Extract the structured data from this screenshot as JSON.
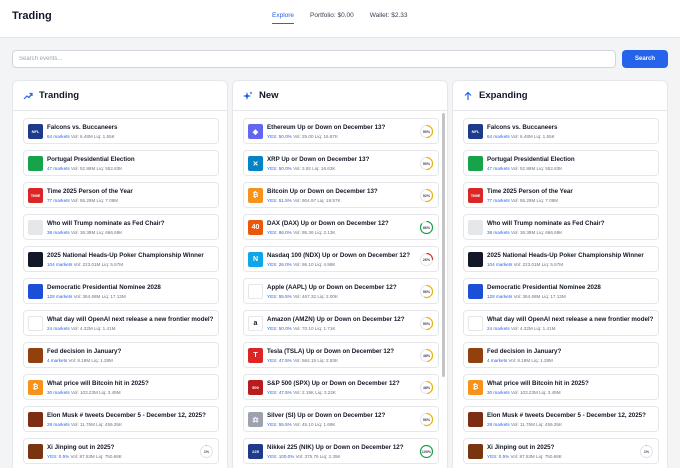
{
  "app": {
    "title": "Trading"
  },
  "nav": {
    "explore": "Explore",
    "portfolio": "Portfolio: $0.00",
    "wallet": "Wallet: $2.33"
  },
  "search": {
    "placeholder": "Search events...",
    "button": "Search"
  },
  "columns": [
    {
      "title": "Tranding",
      "icon": "trending-up-icon",
      "items": [
        {
          "title": "Falcons vs. Buccaneers",
          "meta1": "64 markets",
          "meta2": "Vol: 6.48M  Liq: 1.65K",
          "thumb": "nfl-logo",
          "thumb_color": "#1e3a8a",
          "thumb_text": "NFL"
        },
        {
          "title": "Portugal Presidential Election",
          "meta1": "47 markets",
          "meta2": "Vol: 52.88M  Liq: 552.83K",
          "thumb": "portugal-flag",
          "thumb_color": "#16a34a",
          "thumb_text": ""
        },
        {
          "title": "Time 2025 Person of the Year",
          "meta1": "77 markets",
          "meta2": "Vol: 55.29M  Liq: 7.09M",
          "thumb": "time-magazine-logo",
          "thumb_color": "#dc2626",
          "thumb_text": "TIME"
        },
        {
          "title": "Who will Trump nominate as Fed Chair?",
          "meta1": "38 markets",
          "meta2": "Vol: 36.38M  Liq: 666.69K",
          "thumb": "fed-seal",
          "thumb_color": "#e5e7eb",
          "thumb_text": ""
        },
        {
          "title": "2025 National Heads-Up Poker Championship Winner",
          "meta1": "104 markets",
          "meta2": "Vol: 223.01M  Liq: 5.57M",
          "thumb": "poker-logo",
          "thumb_color": "#111827",
          "thumb_text": ""
        },
        {
          "title": "Democratic Presidential Nominee 2028",
          "meta1": "128 markets",
          "meta2": "Vol: 364.68M  Liq: 17.13M",
          "thumb": "democrat-donkey-logo",
          "thumb_color": "#1d4ed8",
          "thumb_text": ""
        },
        {
          "title": "What day will OpenAI next release a new frontier model?",
          "meta1": "24 markets",
          "meta2": "Vol: 4.32M  Liq: 1.41M",
          "thumb": "openai-logo",
          "thumb_color": "#ffffff",
          "thumb_text": ""
        },
        {
          "title": "Fed decision in January?",
          "meta1": "4 markets",
          "meta2": "Vol: 8.18M  Liq: 1.28M",
          "thumb": "person-photo",
          "thumb_color": "#92400e",
          "thumb_text": ""
        },
        {
          "title": "What price will Bitcoin hit in 2025?",
          "meta1": "30 markets",
          "meta2": "Vol: 103.23M  Liq: 3.49M",
          "thumb": "bitcoin-logo",
          "thumb_color": "#f7931a",
          "thumb_text": "₿"
        },
        {
          "title": "Elon Musk # tweets December 5 - December 12, 2025?",
          "meta1": "28 markets",
          "meta2": "Vol: 11.76M  Liq: 459.25K",
          "thumb": "person-photo",
          "thumb_color": "#7c2d12",
          "thumb_text": ""
        },
        {
          "title": "Xi Jinping out in 2025?",
          "meta1": "YES: 0.5%",
          "meta2": "Vol: 87.53M  Liq: 750.68K",
          "thumb": "person-photo",
          "thumb_color": "#78350f",
          "thumb_text": "",
          "gauge": "1%",
          "gauge_value": 0.01,
          "gauge_color": "#dc2626"
        }
      ]
    },
    {
      "title": "New",
      "icon": "sparkles-icon",
      "items": [
        {
          "title": "Ethereum Up or Down on December 13?",
          "meta1": "YES: 50.0%",
          "meta2": "Vol: 25.00  Liq: 16.87K",
          "thumb": "ethereum-logo",
          "thumb_color": "#6366f1",
          "thumb_text": "◆",
          "gauge": "50%",
          "gauge_value": 0.5,
          "gauge_color": "#eab308"
        },
        {
          "title": "XRP Up or Down on December 13?",
          "meta1": "YES: 50.0%",
          "meta2": "Vol: 3.92  Liq: 16.63K",
          "thumb": "xrp-logo",
          "thumb_color": "#0284c7",
          "thumb_text": "✕",
          "gauge": "50%",
          "gauge_value": 0.5,
          "gauge_color": "#eab308"
        },
        {
          "title": "Bitcoin Up or Down on December 13?",
          "meta1": "YES: 51.5%",
          "meta2": "Vol: 904.97  Liq: 19.57K",
          "thumb": "bitcoin-logo",
          "thumb_color": "#f7931a",
          "thumb_text": "₿",
          "gauge": "52%",
          "gauge_value": 0.52,
          "gauge_color": "#eab308"
        },
        {
          "title": "DAX (DAX) Up or Down on December 12?",
          "meta1": "YES: 86.0%",
          "meta2": "Vol: 95.36  Liq: 2.13K",
          "thumb": "dax-logo",
          "thumb_color": "#ea580c",
          "thumb_text": "40",
          "gauge": "86%",
          "gauge_value": 0.86,
          "gauge_color": "#16a34a"
        },
        {
          "title": "Nasdaq 100 (NDX) Up or Down on December 12?",
          "meta1": "YES: 26.0%",
          "meta2": "Vol: 95.10  Liq: 4.98K",
          "thumb": "nasdaq-logo",
          "thumb_color": "#0ea5e9",
          "thumb_text": "N",
          "gauge": "26%",
          "gauge_value": 0.26,
          "gauge_color": "#dc2626"
        },
        {
          "title": "Apple (AAPL) Up or Down on December 12?",
          "meta1": "YES: 55.5%",
          "meta2": "Vol: 467.32  Liq: 2.00K",
          "thumb": "apple-logo",
          "thumb_color": "#ffffff",
          "thumb_text": "",
          "gauge": "56%",
          "gauge_value": 0.56,
          "gauge_color": "#eab308"
        },
        {
          "title": "Amazon (AMZN) Up or Down on December 12?",
          "meta1": "YES: 50.0%",
          "meta2": "Vol: 70.10  Liq: 1.71K",
          "thumb": "amazon-logo",
          "thumb_color": "#ffffff",
          "thumb_text": "a",
          "gauge": "50%",
          "gauge_value": 0.5,
          "gauge_color": "#eab308"
        },
        {
          "title": "Tesla (TSLA) Up or Down on December 12?",
          "meta1": "YES: 47.5%",
          "meta2": "Vol: 564.15  Liq: 2.83K",
          "thumb": "tesla-logo",
          "thumb_color": "#dc2626",
          "thumb_text": "T",
          "gauge": "48%",
          "gauge_value": 0.48,
          "gauge_color": "#eab308"
        },
        {
          "title": "S&P 500 (SPX) Up or Down on December 12?",
          "meta1": "YES: 47.5%",
          "meta2": "Vol: 2.19K  Liq: 3.22K",
          "thumb": "sp500-logo",
          "thumb_color": "#b91c1c",
          "thumb_text": "500",
          "gauge": "48%",
          "gauge_value": 0.48,
          "gauge_color": "#eab308"
        },
        {
          "title": "Silver (SI) Up or Down on December 12?",
          "meta1": "YES: 55.5%",
          "meta2": "Vol: 45.10  Liq: 1.68K",
          "thumb": "silver-logo",
          "thumb_color": "#9ca3af",
          "thumb_text": "⚖",
          "gauge": "56%",
          "gauge_value": 0.56,
          "gauge_color": "#eab308"
        },
        {
          "title": "Nikkei 225 (NIK) Up or Down on December 12?",
          "meta1": "YES: 100.0%",
          "meta2": "Vol: 375.76  Liq: 2.35K",
          "thumb": "nikkei-logo",
          "thumb_color": "#1e3a8a",
          "thumb_text": "225",
          "gauge": "100%",
          "gauge_value": 1.0,
          "gauge_color": "#16a34a"
        }
      ]
    },
    {
      "title": "Expanding",
      "icon": "arrow-up-icon",
      "items": [
        {
          "title": "Falcons vs. Buccaneers",
          "meta1": "64 markets",
          "meta2": "Vol: 6.48M  Liq: 1.65K",
          "thumb": "nfl-logo",
          "thumb_color": "#1e3a8a",
          "thumb_text": "NFL"
        },
        {
          "title": "Portugal Presidential Election",
          "meta1": "47 markets",
          "meta2": "Vol: 52.88M  Liq: 552.83K",
          "thumb": "portugal-flag",
          "thumb_color": "#16a34a",
          "thumb_text": ""
        },
        {
          "title": "Time 2025 Person of the Year",
          "meta1": "77 markets",
          "meta2": "Vol: 55.29M  Liq: 7.09M",
          "thumb": "time-magazine-logo",
          "thumb_color": "#dc2626",
          "thumb_text": "TIME"
        },
        {
          "title": "Who will Trump nominate as Fed Chair?",
          "meta1": "38 markets",
          "meta2": "Vol: 36.38M  Liq: 666.69K",
          "thumb": "fed-seal",
          "thumb_color": "#e5e7eb",
          "thumb_text": ""
        },
        {
          "title": "2025 National Heads-Up Poker Championship Winner",
          "meta1": "104 markets",
          "meta2": "Vol: 223.01M  Liq: 5.57M",
          "thumb": "poker-logo",
          "thumb_color": "#111827",
          "thumb_text": ""
        },
        {
          "title": "Democratic Presidential Nominee 2028",
          "meta1": "128 markets",
          "meta2": "Vol: 364.68M  Liq: 17.13M",
          "thumb": "democrat-donkey-logo",
          "thumb_color": "#1d4ed8",
          "thumb_text": ""
        },
        {
          "title": "What day will OpenAI next release a new frontier model?",
          "meta1": "24 markets",
          "meta2": "Vol: 4.32M  Liq: 1.41M",
          "thumb": "openai-logo",
          "thumb_color": "#ffffff",
          "thumb_text": ""
        },
        {
          "title": "Fed decision in January?",
          "meta1": "4 markets",
          "meta2": "Vol: 8.18M  Liq: 1.28M",
          "thumb": "person-photo",
          "thumb_color": "#92400e",
          "thumb_text": ""
        },
        {
          "title": "What price will Bitcoin hit in 2025?",
          "meta1": "30 markets",
          "meta2": "Vol: 103.23M  Liq: 3.49M",
          "thumb": "bitcoin-logo",
          "thumb_color": "#f7931a",
          "thumb_text": "₿"
        },
        {
          "title": "Elon Musk # tweets December 5 - December 12, 2025?",
          "meta1": "28 markets",
          "meta2": "Vol: 11.76M  Liq: 459.25K",
          "thumb": "person-photo",
          "thumb_color": "#7c2d12",
          "thumb_text": ""
        },
        {
          "title": "Xi Jinping out in 2025?",
          "meta1": "YES: 0.5%",
          "meta2": "Vol: 87.53M  Liq: 750.68K",
          "thumb": "person-photo",
          "thumb_color": "#78350f",
          "thumb_text": "",
          "gauge": "1%",
          "gauge_value": 0.01,
          "gauge_color": "#dc2626"
        }
      ]
    }
  ]
}
